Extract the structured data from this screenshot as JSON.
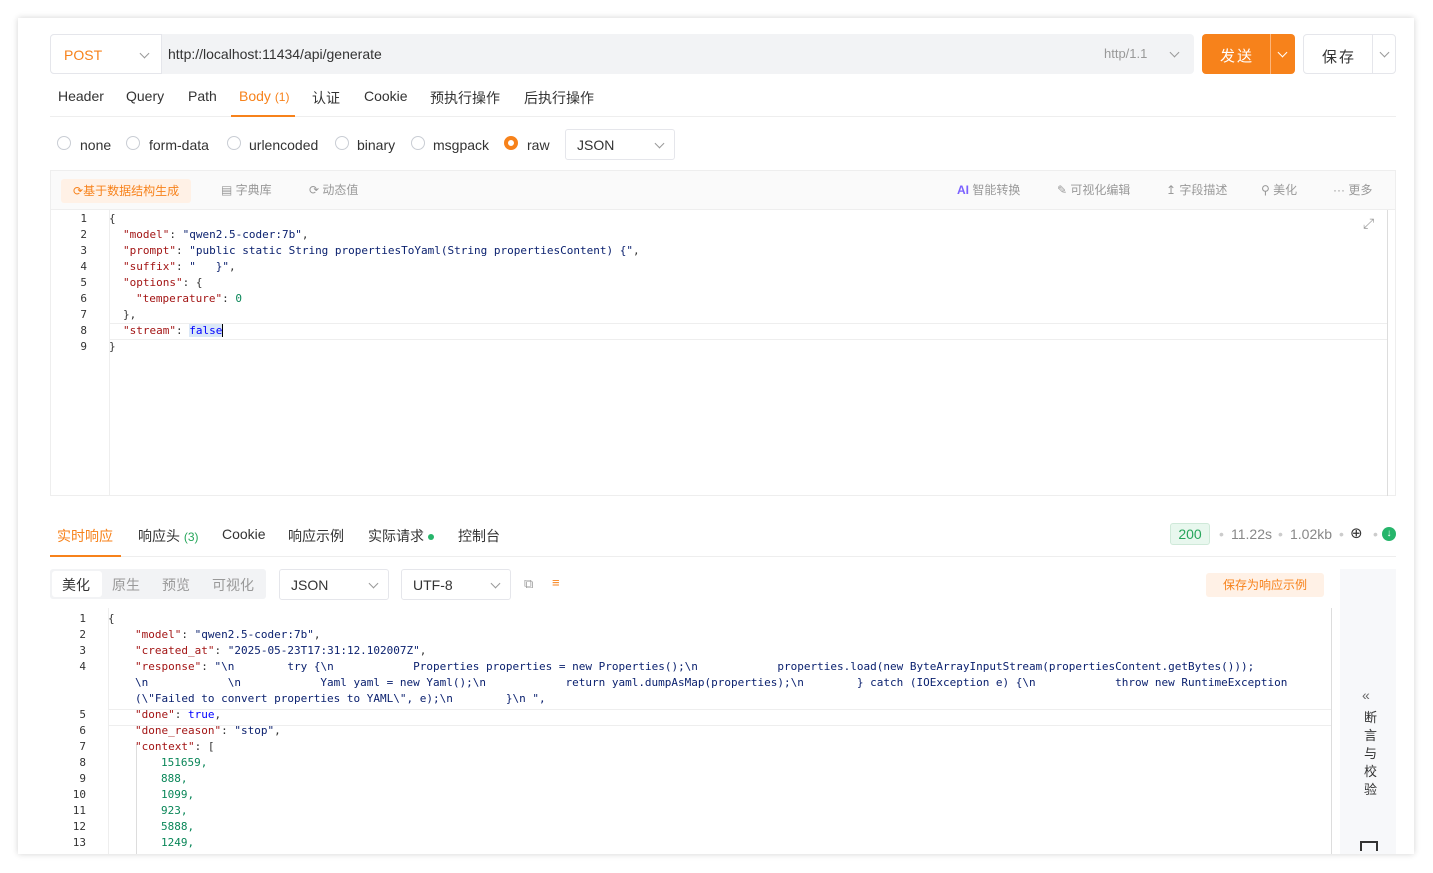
{
  "request": {
    "method": "POST",
    "url": "http://localhost:11434/api/generate",
    "protocol": "http/1.1",
    "send_label": "发送",
    "save_label": "保存"
  },
  "tabs": [
    {
      "label": "Header"
    },
    {
      "label": "Query"
    },
    {
      "label": "Path"
    },
    {
      "label": "Body",
      "count": "(1)"
    },
    {
      "label": "认证"
    },
    {
      "label": "Cookie"
    },
    {
      "label": "预执行操作"
    },
    {
      "label": "后执行操作"
    }
  ],
  "body_types": [
    "none",
    "form-data",
    "urlencoded",
    "binary",
    "msgpack",
    "raw"
  ],
  "body_type_selected": "raw",
  "body_format": "JSON",
  "editor_toolbar": {
    "generate": "基于数据结构生成",
    "dictionary": "字典库",
    "dynamic": "动态值",
    "ai_convert": "智能转换",
    "ai_badge": "AI",
    "visual_edit": "可视化编辑",
    "field_desc": "字段描述",
    "beautify": "美化",
    "more": "更多"
  },
  "request_body_lines": [
    "1",
    "2",
    "3",
    "4",
    "5",
    "6",
    "7",
    "8",
    "9"
  ],
  "request_body": {
    "l1": "{",
    "l2_key": "\"model\"",
    "l2_val": "\"qwen2.5-coder:7b\"",
    "l3_key": "\"prompt\"",
    "l3_val": "\"public static String propertiesToYaml(String propertiesContent) {\"",
    "l4_key": "\"suffix\"",
    "l4_val": "\"   }\"",
    "l5_key": "\"options\"",
    "l5_val": "{",
    "l6_key": "\"temperature\"",
    "l6_val": "0",
    "l7": "},",
    "l8_key": "\"stream\"",
    "l8_val": "false",
    "l9": "}"
  },
  "response_tabs": [
    {
      "label": "实时响应"
    },
    {
      "label": "响应头",
      "count": "(3)"
    },
    {
      "label": "Cookie"
    },
    {
      "label": "响应示例"
    },
    {
      "label": "实际请求"
    },
    {
      "label": "控制台"
    }
  ],
  "response_meta": {
    "status": "200",
    "time": "11.22s",
    "size": "1.02kb"
  },
  "response_view": {
    "modes": [
      "美化",
      "原生",
      "预览",
      "可视化"
    ],
    "format": "JSON",
    "encoding": "UTF-8",
    "save_example": "保存为响应示例",
    "side_label": [
      "断",
      "言",
      "与",
      "校",
      "验"
    ],
    "collapse_icon": "«"
  },
  "response_body": {
    "l1": "{",
    "model_key": "\"model\"",
    "model_val": "\"qwen2.5-coder:7b\"",
    "created_key": "\"created_at\"",
    "created_val": "\"2025-05-23T17:31:12.102007Z\"",
    "response_key": "\"response\"",
    "response_val_1": "\"\\n        try {\\n            Properties properties = new Properties();\\n            properties.load(new ByteArrayInputStream(propertiesContent.getBytes()));",
    "response_val_2": "\\n            \\n            Yaml yaml = new Yaml();\\n            return yaml.dumpAsMap(properties);\\n        } catch (IOException e) {\\n            throw new RuntimeException",
    "response_val_3": "(\\\"Failed to convert properties to YAML\\\", e);\\n        }\\n \",",
    "done_key": "\"done\"",
    "done_val": "true",
    "reason_key": "\"done_reason\"",
    "reason_val": "\"stop\"",
    "context_key": "\"context\"",
    "context_val": "[",
    "context": [
      "151659,",
      "888,",
      "1099,",
      "923,",
      "5888,",
      "1249,"
    ],
    "line_numbers": [
      "1",
      "2",
      "3",
      "4",
      "5",
      "6",
      "7",
      "8",
      "9",
      "10",
      "11",
      "12",
      "13"
    ]
  }
}
